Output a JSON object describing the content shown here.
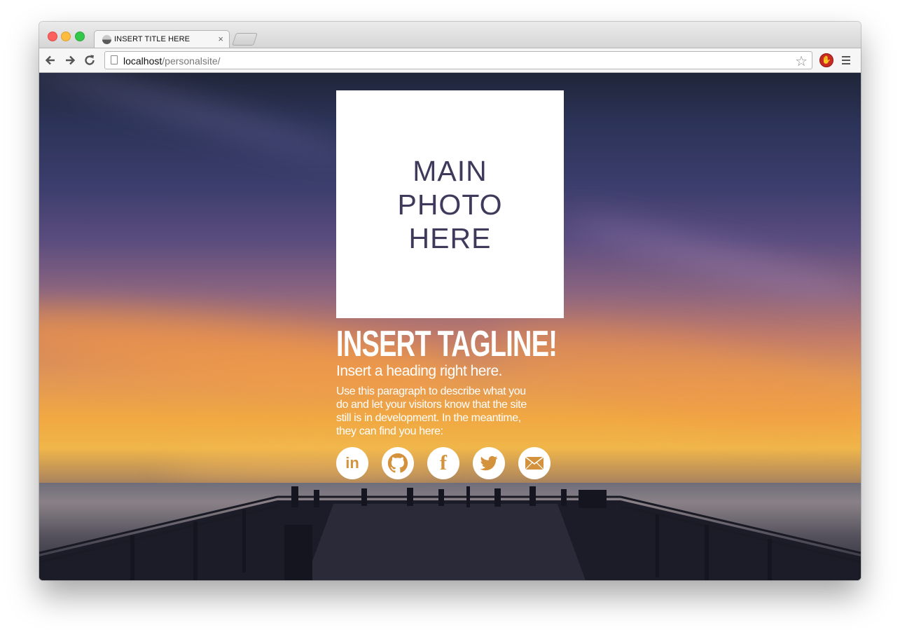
{
  "browser": {
    "tab_title": "INSERT TITLE HERE",
    "tab_close": "×",
    "url_host": "localhost",
    "url_path": "/personalsite/"
  },
  "page": {
    "photo_placeholder": "MAIN PHOTO HERE",
    "tagline": "INSERT TAGLINE!",
    "subheading": "Insert a heading right here.",
    "paragraph": "Use this paragraph to describe what you do and let your visitors know that the site still is in development. In the meantime, they can find you here:",
    "social_links": [
      {
        "name": "linkedin",
        "label": "in"
      },
      {
        "name": "github",
        "label": ""
      },
      {
        "name": "facebook",
        "label": "f"
      },
      {
        "name": "twitter",
        "label": ""
      },
      {
        "name": "email",
        "label": ""
      }
    ]
  },
  "colors": {
    "placeholder_text": "#3f3a5c",
    "icon_accent": "#d5923c"
  }
}
